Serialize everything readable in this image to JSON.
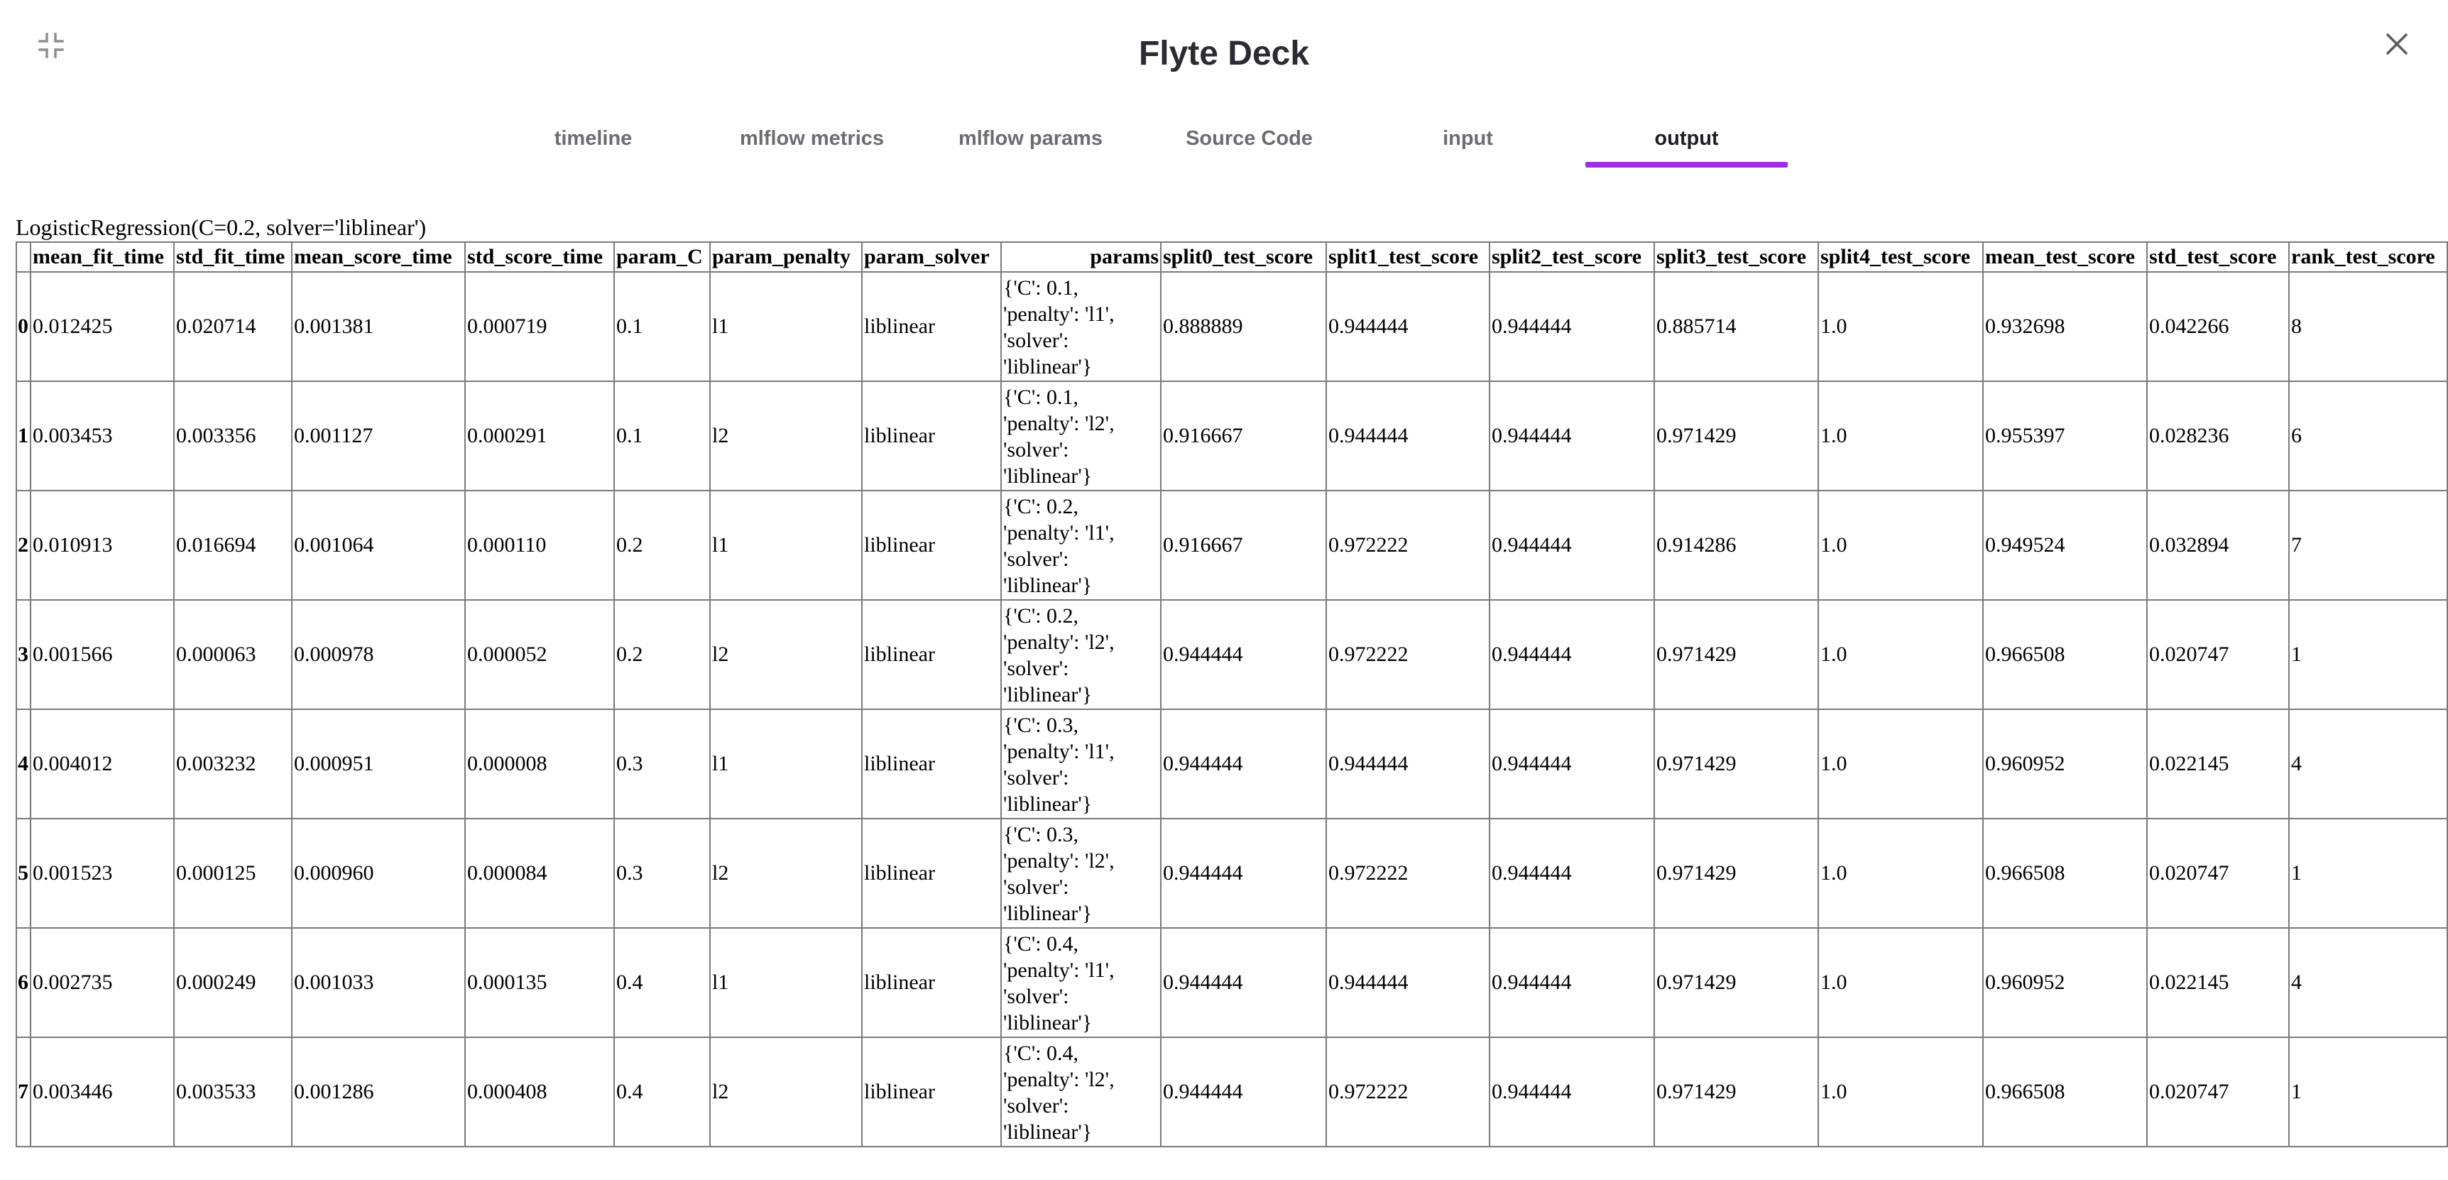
{
  "window": {
    "title": "Flyte Deck",
    "collapse_icon": "collapse-icon",
    "close_icon": "close-icon"
  },
  "tabs": [
    {
      "label": "timeline",
      "active": false
    },
    {
      "label": "mlflow metrics",
      "active": false
    },
    {
      "label": "mlflow params",
      "active": false
    },
    {
      "label": "Source Code",
      "active": false
    },
    {
      "label": "input",
      "active": false
    },
    {
      "label": "output",
      "active": true
    }
  ],
  "accent_color": "#9b30e8",
  "output": {
    "caption": "LogisticRegression(C=0.2, solver='liblinear')",
    "columns": [
      "",
      "mean_fit_time",
      "std_fit_time",
      "mean_score_time",
      "std_score_time",
      "param_C",
      "param_penalty",
      "param_solver",
      "params",
      "split0_test_score",
      "split1_test_score",
      "split2_test_score",
      "split3_test_score",
      "split4_test_score",
      "mean_test_score",
      "std_test_score",
      "rank_test_score"
    ],
    "rows": [
      {
        "index": "0",
        "mean_fit_time": "0.012425",
        "std_fit_time": "0.020714",
        "mean_score_time": "0.001381",
        "std_score_time": "0.000719",
        "param_C": "0.1",
        "param_penalty": "l1",
        "param_solver": "liblinear",
        "params": [
          "{'C': 0.1,",
          "'penalty': 'l1',",
          "'solver':",
          "'liblinear'}"
        ],
        "split0_test_score": "0.888889",
        "split1_test_score": "0.944444",
        "split2_test_score": "0.944444",
        "split3_test_score": "0.885714",
        "split4_test_score": "1.0",
        "mean_test_score": "0.932698",
        "std_test_score": "0.042266",
        "rank_test_score": "8"
      },
      {
        "index": "1",
        "mean_fit_time": "0.003453",
        "std_fit_time": "0.003356",
        "mean_score_time": "0.001127",
        "std_score_time": "0.000291",
        "param_C": "0.1",
        "param_penalty": "l2",
        "param_solver": "liblinear",
        "params": [
          "{'C': 0.1,",
          "'penalty': 'l2',",
          "'solver':",
          "'liblinear'}"
        ],
        "split0_test_score": "0.916667",
        "split1_test_score": "0.944444",
        "split2_test_score": "0.944444",
        "split3_test_score": "0.971429",
        "split4_test_score": "1.0",
        "mean_test_score": "0.955397",
        "std_test_score": "0.028236",
        "rank_test_score": "6"
      },
      {
        "index": "2",
        "mean_fit_time": "0.010913",
        "std_fit_time": "0.016694",
        "mean_score_time": "0.001064",
        "std_score_time": "0.000110",
        "param_C": "0.2",
        "param_penalty": "l1",
        "param_solver": "liblinear",
        "params": [
          "{'C': 0.2,",
          "'penalty': 'l1',",
          "'solver':",
          "'liblinear'}"
        ],
        "split0_test_score": "0.916667",
        "split1_test_score": "0.972222",
        "split2_test_score": "0.944444",
        "split3_test_score": "0.914286",
        "split4_test_score": "1.0",
        "mean_test_score": "0.949524",
        "std_test_score": "0.032894",
        "rank_test_score": "7"
      },
      {
        "index": "3",
        "mean_fit_time": "0.001566",
        "std_fit_time": "0.000063",
        "mean_score_time": "0.000978",
        "std_score_time": "0.000052",
        "param_C": "0.2",
        "param_penalty": "l2",
        "param_solver": "liblinear",
        "params": [
          "{'C': 0.2,",
          "'penalty': 'l2',",
          "'solver':",
          "'liblinear'}"
        ],
        "split0_test_score": "0.944444",
        "split1_test_score": "0.972222",
        "split2_test_score": "0.944444",
        "split3_test_score": "0.971429",
        "split4_test_score": "1.0",
        "mean_test_score": "0.966508",
        "std_test_score": "0.020747",
        "rank_test_score": "1"
      },
      {
        "index": "4",
        "mean_fit_time": "0.004012",
        "std_fit_time": "0.003232",
        "mean_score_time": "0.000951",
        "std_score_time": "0.000008",
        "param_C": "0.3",
        "param_penalty": "l1",
        "param_solver": "liblinear",
        "params": [
          "{'C': 0.3,",
          "'penalty': 'l1',",
          "'solver':",
          "'liblinear'}"
        ],
        "split0_test_score": "0.944444",
        "split1_test_score": "0.944444",
        "split2_test_score": "0.944444",
        "split3_test_score": "0.971429",
        "split4_test_score": "1.0",
        "mean_test_score": "0.960952",
        "std_test_score": "0.022145",
        "rank_test_score": "4"
      },
      {
        "index": "5",
        "mean_fit_time": "0.001523",
        "std_fit_time": "0.000125",
        "mean_score_time": "0.000960",
        "std_score_time": "0.000084",
        "param_C": "0.3",
        "param_penalty": "l2",
        "param_solver": "liblinear",
        "params": [
          "{'C': 0.3,",
          "'penalty': 'l2',",
          "'solver':",
          "'liblinear'}"
        ],
        "split0_test_score": "0.944444",
        "split1_test_score": "0.972222",
        "split2_test_score": "0.944444",
        "split3_test_score": "0.971429",
        "split4_test_score": "1.0",
        "mean_test_score": "0.966508",
        "std_test_score": "0.020747",
        "rank_test_score": "1"
      },
      {
        "index": "6",
        "mean_fit_time": "0.002735",
        "std_fit_time": "0.000249",
        "mean_score_time": "0.001033",
        "std_score_time": "0.000135",
        "param_C": "0.4",
        "param_penalty": "l1",
        "param_solver": "liblinear",
        "params": [
          "{'C': 0.4,",
          "'penalty': 'l1',",
          "'solver':",
          "'liblinear'}"
        ],
        "split0_test_score": "0.944444",
        "split1_test_score": "0.944444",
        "split2_test_score": "0.944444",
        "split3_test_score": "0.971429",
        "split4_test_score": "1.0",
        "mean_test_score": "0.960952",
        "std_test_score": "0.022145",
        "rank_test_score": "4"
      },
      {
        "index": "7",
        "mean_fit_time": "0.003446",
        "std_fit_time": "0.003533",
        "mean_score_time": "0.001286",
        "std_score_time": "0.000408",
        "param_C": "0.4",
        "param_penalty": "l2",
        "param_solver": "liblinear",
        "params": [
          "{'C': 0.4,",
          "'penalty': 'l2',",
          "'solver':",
          "'liblinear'}"
        ],
        "split0_test_score": "0.944444",
        "split1_test_score": "0.972222",
        "split2_test_score": "0.944444",
        "split3_test_score": "0.971429",
        "split4_test_score": "1.0",
        "mean_test_score": "0.966508",
        "std_test_score": "0.020747",
        "rank_test_score": "1"
      }
    ]
  }
}
